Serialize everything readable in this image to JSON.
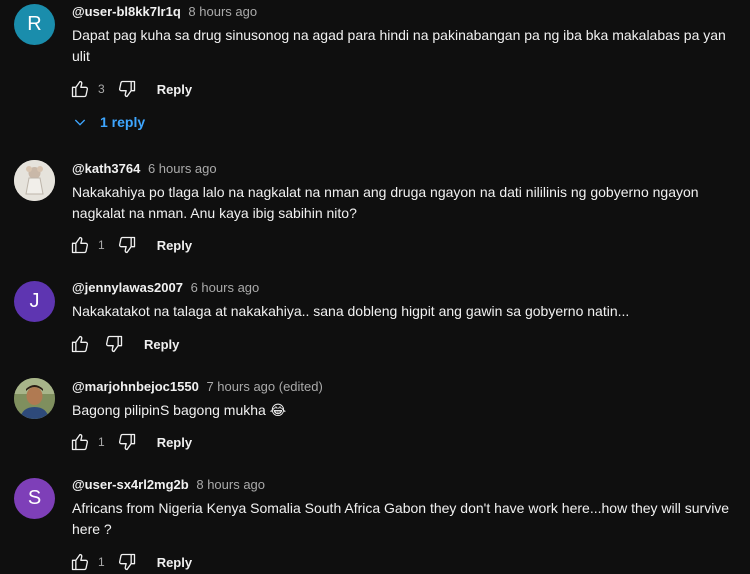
{
  "comments": [
    {
      "avatar_letter": "R",
      "avatar_color": "#1a8dac",
      "author": "@user-bl8kk7lr1q",
      "time": "8 hours ago",
      "text": "Dapat pag kuha sa drug sinusonog na agad para hindi na pakinabangan pa ng iba bka makalabas pa yan ulit",
      "likes": "3",
      "reply_label": "Reply",
      "replies_label": "1 reply"
    },
    {
      "avatar_letter": "",
      "avatar_color": "#d9d6cf",
      "author": "@kath3764",
      "time": "6 hours ago",
      "text": "Nakakahiya po tlaga lalo na nagkalat na nman ang druga ngayon na dati nililinis ng gobyerno ngayon nagkalat na nman. Anu kaya ibig sabihin nito?",
      "likes": "1",
      "reply_label": "Reply"
    },
    {
      "avatar_letter": "J",
      "avatar_color": "#5e35b1",
      "author": "@jennylawas2007",
      "time": "6 hours ago",
      "text": "Nakakatakot na talaga at nakakahiya..  sana dobleng higpit ang gawin sa gobyerno  natin...",
      "likes": "",
      "reply_label": "Reply"
    },
    {
      "avatar_letter": "",
      "avatar_color": "#6b7c52",
      "author": "@marjohnbejoc1550",
      "time": "7 hours ago (edited)",
      "text": "Bagong pilipinS bagong mukha 😂",
      "likes": "1",
      "reply_label": "Reply"
    },
    {
      "avatar_letter": "S",
      "avatar_color": "#7e3fb8",
      "author": "@user-sx4rl2mg2b",
      "time": "8 hours ago",
      "text": "Africans from Nigeria Kenya Somalia South Africa Gabon they don't have work here...how they will survive here ?",
      "likes": "1",
      "reply_label": "Reply"
    }
  ]
}
